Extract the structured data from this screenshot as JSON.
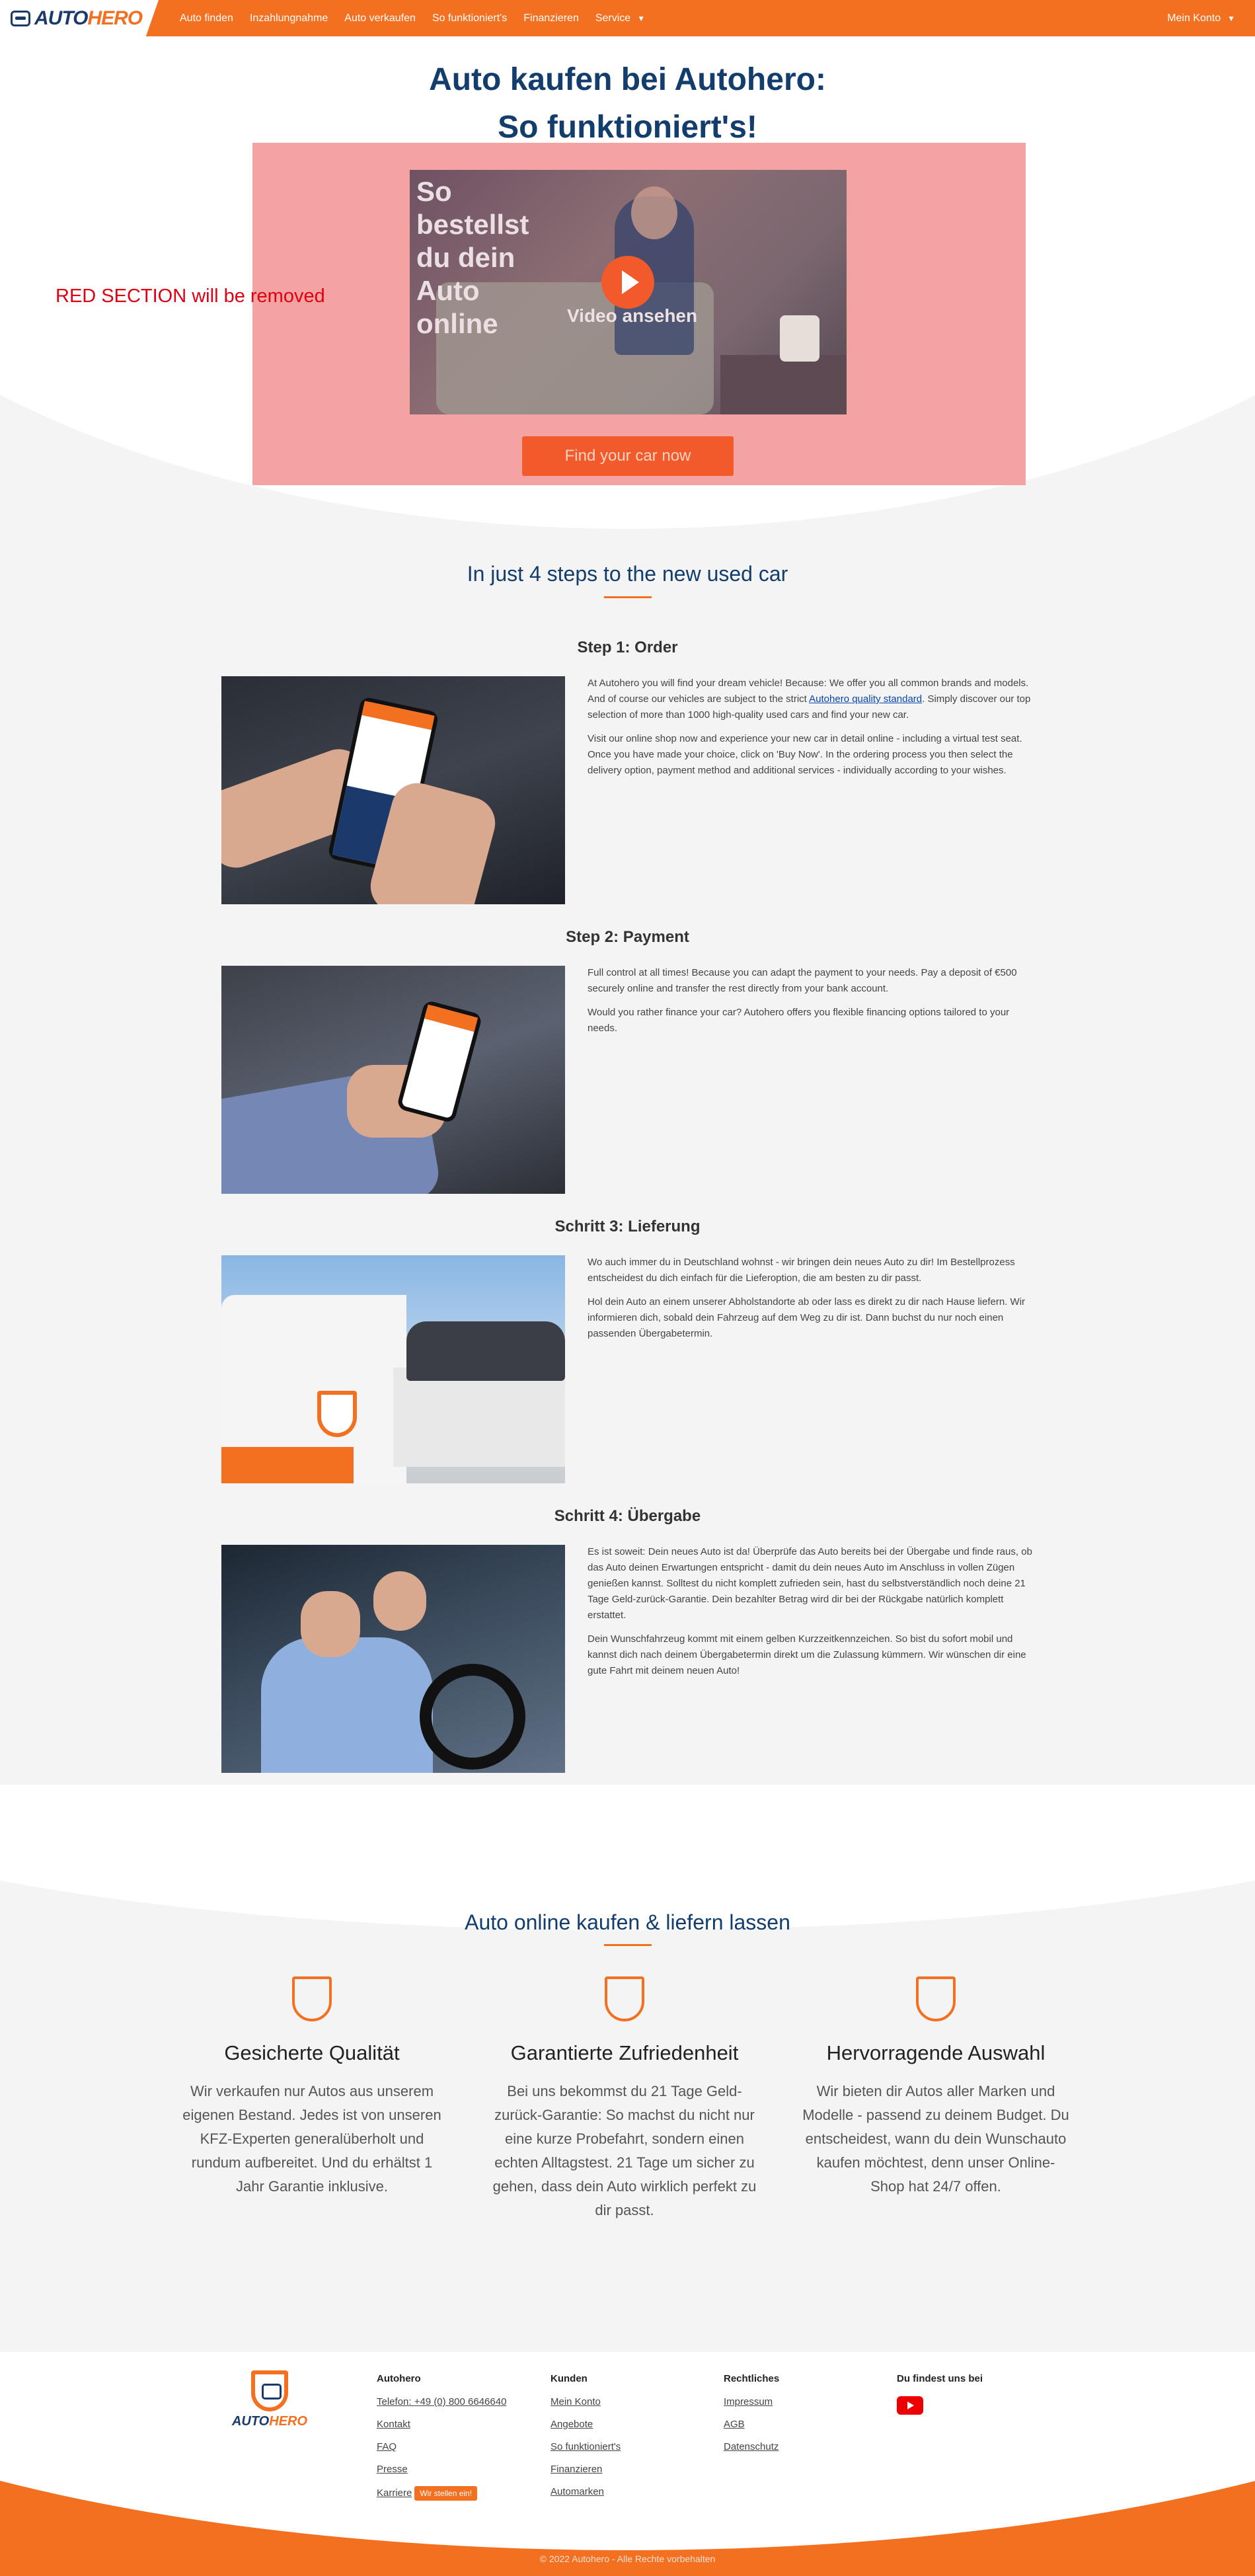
{
  "nav": {
    "brand": {
      "auto": "AUTO",
      "hero": "HERO"
    },
    "links": [
      "Auto finden",
      "Inzahlungnahme",
      "Auto verkaufen",
      "So funktioniert's",
      "Finanzieren",
      "Service"
    ],
    "account": "Mein Konto"
  },
  "hero": {
    "title_line1": "Auto kaufen bei Autohero:",
    "title_line2": "So funktioniert's!",
    "red_note": "RED SECTION will be removed",
    "video_overlay": "So bestellst du dein Auto online",
    "video_label": "Video ansehen",
    "cta": "Find your car now"
  },
  "steps": {
    "heading": "In just 4 steps to the new used car",
    "items": [
      {
        "title": "Step 1: Order",
        "p1_before": "At Autohero you will find your dream vehicle! Because: We offer you all common brands and models. And of course our vehicles are subject to the strict ",
        "p1_link": "Autohero quality standard",
        "p1_after": ". Simply discover our top selection of more than 1000 high-quality used cars and find your new car.",
        "p2": "Visit our online shop now and experience your new car in detail online - including a virtual test seat. Once you have made your choice, click on 'Buy Now'. In the ordering process you then select the delivery option, payment method and additional services - individually according to your wishes."
      },
      {
        "title": "Step 2: Payment",
        "p1": "Full control at all times! Because you can adapt the payment to your needs. Pay a deposit of €500 securely online and transfer the rest directly from your bank account.",
        "p2": "Would you rather finance your car? Autohero offers you flexible financing options tailored to your needs."
      },
      {
        "title": "Schritt 3: Lieferung",
        "p1": "Wo auch immer du in Deutschland wohnst - wir bringen dein neues Auto zu dir! Im Bestellprozess entscheidest du dich einfach für die Lieferoption, die am besten zu dir passt.",
        "p2": "Hol dein Auto an einem unserer Abholstandorte ab oder lass es direkt zu dir nach Hause liefern. Wir informieren dich, sobald dein Fahrzeug auf dem Weg zu dir ist. Dann buchst du nur noch einen passenden Übergabetermin."
      },
      {
        "title": "Schritt 4: Übergabe",
        "p1": "Es ist soweit: Dein neues Auto ist da! Überprüfe das Auto bereits bei der Übergabe und finde raus, ob das Auto deinen Erwartungen entspricht - damit du dein neues Auto im Anschluss in vollen Zügen genießen kannst. Solltest du nicht komplett zufrieden sein, hast du selbstverständlich noch deine 21 Tage Geld-zurück-Garantie. Dein bezahlter Betrag wird dir bei der Rückgabe natürlich komplett erstattet.",
        "p2": "Dein Wunschfahrzeug kommt mit einem gelben Kurzzeitkennzeichen. So bist du sofort mobil und kannst dich nach deinem Übergabetermin direkt um die Zulassung kümmern. Wir wünschen dir eine gute Fahrt mit deinem neuen Auto!"
      }
    ]
  },
  "features": {
    "heading": "Auto online kaufen & liefern lassen",
    "items": [
      {
        "icon": "shield-icon",
        "title": "Gesicherte Qualität",
        "text": "Wir verkaufen nur Autos aus unserem eigenen Bestand. Jedes ist von unseren KFZ-Experten generalüberholt und rundum aufbereitet. Und du erhältst 1 Jahr Garantie inklusive."
      },
      {
        "icon": "shield-icon",
        "title": "Garantierte Zufriedenheit",
        "text": "Bei uns bekommst du 21 Tage Geld-zurück-Garantie: So machst du nicht nur eine kurze Probefahrt, sondern einen echten Alltagstest. 21 Tage um sicher zu gehen, dass dein Auto wirklich perfekt zu dir passt."
      },
      {
        "icon": "shield-icon",
        "title": "Hervorragende Auswahl",
        "text": "Wir bieten dir Autos aller Marken und Modelle - passend zu deinem Budget. Du entscheidest, wann du dein Wunschauto kaufen möchtest, denn unser Online-Shop hat 24/7 offen."
      }
    ]
  },
  "footer": {
    "brand": {
      "auto": "AUTO",
      "hero": "HERO"
    },
    "col1": {
      "title": "Autohero",
      "links": [
        "Telefon: +49 (0) 800 6646640",
        "Kontakt",
        "FAQ",
        "Presse",
        "Karriere"
      ],
      "badge": "Wir stellen ein!"
    },
    "col2": {
      "title": "Kunden",
      "links": [
        "Mein Konto",
        "Angebote",
        "So funktioniert's",
        "Finanzieren",
        "Automarken"
      ]
    },
    "col3": {
      "title": "Rechtliches",
      "links": [
        "Impressum",
        "AGB",
        "Datenschutz"
      ]
    },
    "col4": {
      "title": "Du findest uns bei",
      "icon": "youtube-icon"
    },
    "copyright": "© 2022 Autohero - Alle Rechte vorbehalten"
  },
  "colors": {
    "accent": "#f37021",
    "brand_blue": "#123d6d",
    "cta": "#f25a2c"
  }
}
